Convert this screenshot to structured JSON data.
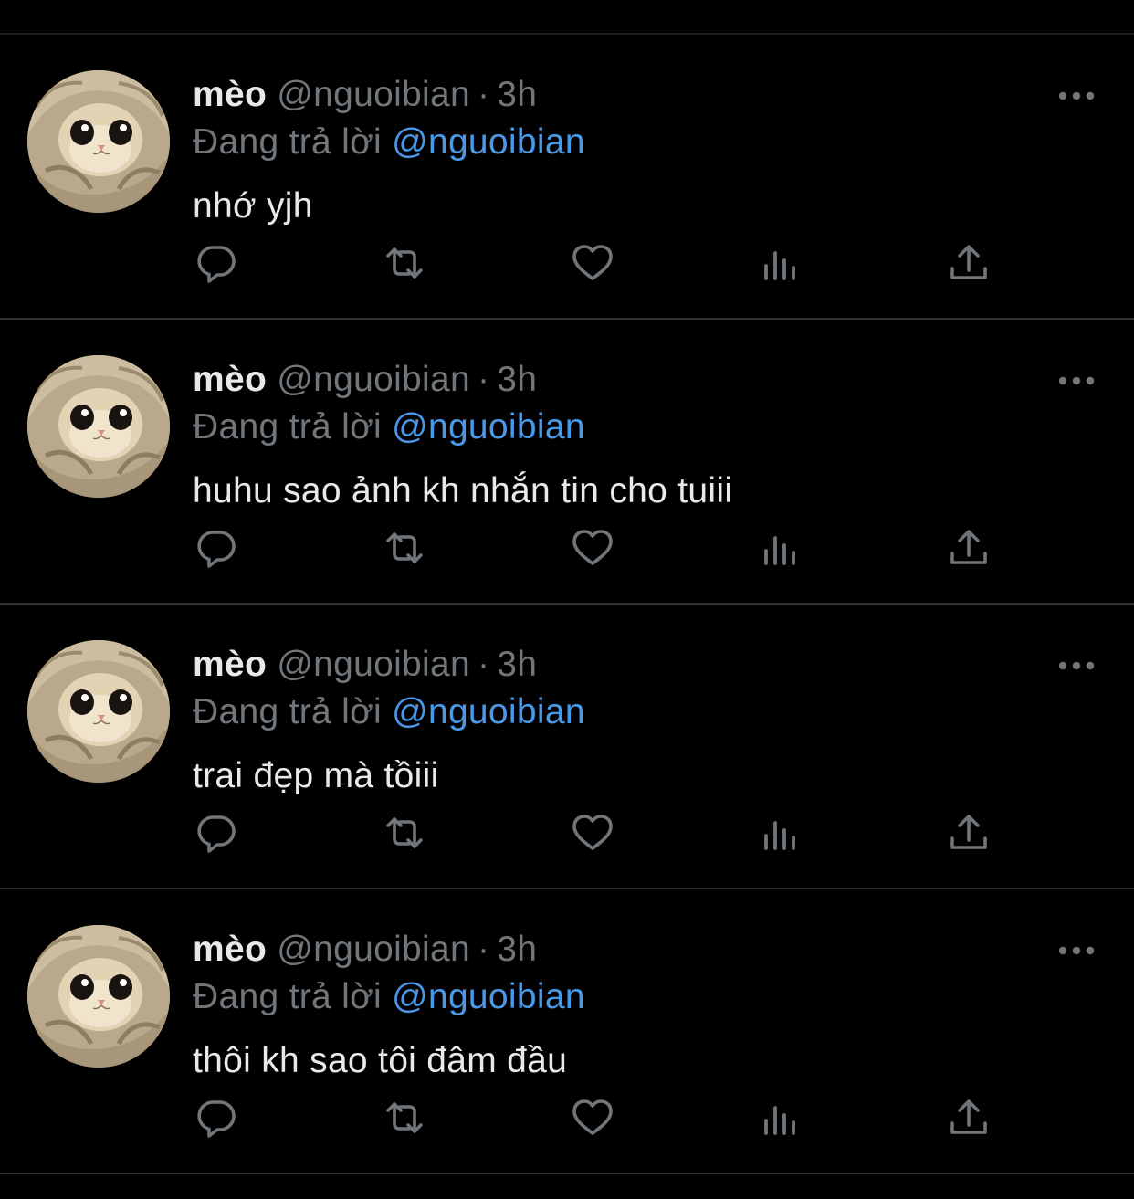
{
  "tweets": [
    {
      "name": "mèo",
      "handle": "@nguoibian",
      "separator": "·",
      "time": "3h",
      "reply_prefix": "Đang trả lời",
      "reply_to": "@nguoibian",
      "text": "nhớ yjh"
    },
    {
      "name": "mèo",
      "handle": "@nguoibian",
      "separator": "·",
      "time": "3h",
      "reply_prefix": "Đang trả lời",
      "reply_to": "@nguoibian",
      "text": "huhu sao ảnh kh nhắn tin cho tuiii"
    },
    {
      "name": "mèo",
      "handle": "@nguoibian",
      "separator": "·",
      "time": "3h",
      "reply_prefix": "Đang trả lời",
      "reply_to": "@nguoibian",
      "text": "trai đẹp mà tồiii"
    },
    {
      "name": "mèo",
      "handle": "@nguoibian",
      "separator": "·",
      "time": "3h",
      "reply_prefix": "Đang trả lời",
      "reply_to": "@nguoibian",
      "text": "thôi kh sao tôi đâm đầu"
    }
  ],
  "icons": {
    "avatar": "cat-avatar-icon",
    "more": "more-icon",
    "reply": "reply-icon",
    "retweet": "retweet-icon",
    "like": "heart-icon",
    "views": "views-icon",
    "share": "share-icon"
  },
  "colors": {
    "background": "#000000",
    "text": "#e7e9ea",
    "muted": "#71767b",
    "mention": "#4a99e9",
    "divider": "#2f3336"
  }
}
